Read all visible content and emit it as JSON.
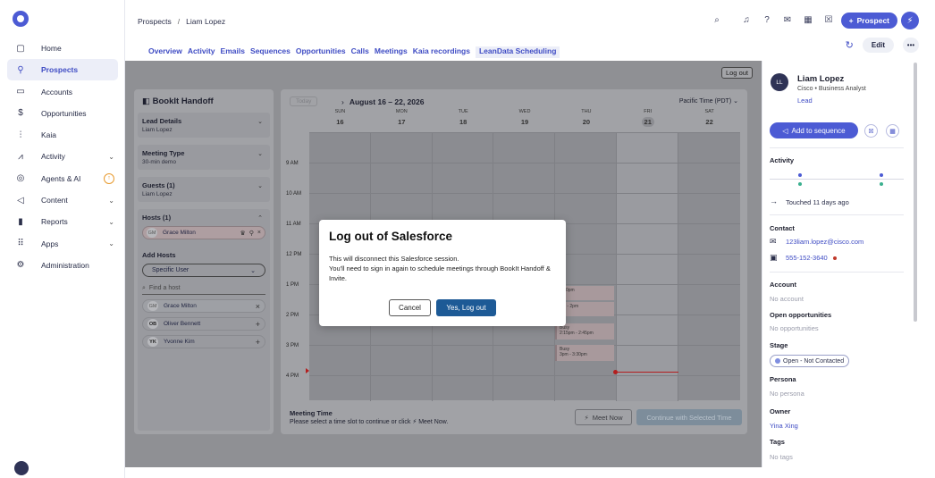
{
  "sidebar": {
    "items": [
      {
        "label": "Home",
        "icon": "home-icon",
        "glyph": "▢",
        "chevron": ""
      },
      {
        "label": "Prospects",
        "icon": "person-icon",
        "glyph": "⚲",
        "chevron": ""
      },
      {
        "label": "Accounts",
        "icon": "briefcase-icon",
        "glyph": "▭",
        "chevron": ""
      },
      {
        "label": "Opportunities",
        "icon": "dollar-icon",
        "glyph": "$",
        "chevron": ""
      },
      {
        "label": "Kaia",
        "icon": "waveform-icon",
        "glyph": "⫶",
        "chevron": ""
      },
      {
        "label": "Activity",
        "icon": "activity-icon",
        "glyph": "⩘",
        "chevron": "⌄"
      },
      {
        "label": "Agents & AI",
        "icon": "agents-icon",
        "glyph": "◎",
        "chevron": ""
      },
      {
        "label": "Content",
        "icon": "send-icon",
        "glyph": "◁",
        "chevron": "⌄"
      },
      {
        "label": "Reports",
        "icon": "bar-chart-icon",
        "glyph": "▮",
        "chevron": "⌄"
      },
      {
        "label": "Apps",
        "icon": "grid-icon",
        "glyph": "⠿",
        "chevron": "⌄"
      },
      {
        "label": "Administration",
        "icon": "gear-icon",
        "glyph": "⚙",
        "chevron": ""
      }
    ]
  },
  "topbar": {
    "breadcrumb_parent": "Prospects",
    "breadcrumb_sep": "/",
    "breadcrumb_current": "Liam Lopez",
    "new_prospect_label": "Prospect"
  },
  "tabs": [
    "Overview",
    "Activity",
    "Emails",
    "Sequences",
    "Opportunities",
    "Calls",
    "Meetings",
    "Kaia recordings",
    "LeanData Scheduling"
  ],
  "edit_label": "Edit",
  "main": {
    "logout_label": "Log out",
    "bookit": {
      "title": "BookIt Handoff",
      "lead_details_title": "Lead Details",
      "lead_details_value": "Liam Lopez",
      "meeting_type_title": "Meeting Type",
      "meeting_type_value": "30-min demo",
      "guests_title": "Guests (1)",
      "guests_value": "Liam Lopez",
      "hosts_title": "Hosts (1)",
      "selected_host_initials": "GM",
      "selected_host_name": "Grace Milton",
      "add_hosts_title": "Add Hosts",
      "user_select_value": "Specific User",
      "find_host_placeholder": "Find a host",
      "host_list": [
        {
          "initials": "GM",
          "name": "Grace Milton",
          "action": "×"
        },
        {
          "initials": "OB",
          "name": "Oliver Bennett",
          "action": "+"
        },
        {
          "initials": "YK",
          "name": "Yvonne Kim",
          "action": "+"
        }
      ]
    },
    "calendar": {
      "today_label": "Today",
      "range": "August 16 – 22, 2026",
      "timezone": "Pacific Time (PDT)",
      "days": [
        {
          "dow": "SUN",
          "num": "16"
        },
        {
          "dow": "MON",
          "num": "17"
        },
        {
          "dow": "TUE",
          "num": "18"
        },
        {
          "dow": "WED",
          "num": "19"
        },
        {
          "dow": "THU",
          "num": "20"
        },
        {
          "dow": "FRI",
          "num": "21"
        },
        {
          "dow": "SAT",
          "num": "22"
        }
      ],
      "hours": [
        "9 AM",
        "10 AM",
        "11 AM",
        "12 PM",
        "1 PM",
        "2 PM",
        "3 PM",
        "4 PM"
      ],
      "events": [
        {
          "title": "",
          "time": "1:30pm"
        },
        {
          "title": "",
          "time": "om - 2pm"
        },
        {
          "title": "Busy",
          "time": "2:15pm - 2:45pm"
        },
        {
          "title": "Busy",
          "time": "3pm - 3:30pm"
        }
      ],
      "meeting_time_title": "Meeting Time",
      "meeting_time_hint": "Please select a time slot to continue or click ⚡ Meet Now.",
      "meet_now_label": "Meet Now",
      "continue_label": "Continue with Selected Time"
    }
  },
  "modal": {
    "title": "Log out of Salesforce",
    "body_line1": "This will disconnect this Salesforce session.",
    "body_line2": "You'll need to sign in again to schedule meetings through BookIt Handoff & Invite.",
    "cancel_label": "Cancel",
    "confirm_label": "Yes, Log out"
  },
  "right_panel": {
    "avatar_initials": "LL",
    "name": "Liam Lopez",
    "company_title": "Cisco • Business Analyst",
    "type": "Lead",
    "add_sequence_label": "Add to sequence",
    "activity_title": "Activity",
    "touched": "Touched 11 days ago",
    "contact_title": "Contact",
    "email": "123liam.lopez@cisco.com",
    "phone": "555-152-3640",
    "account_title": "Account",
    "account_value": "No account",
    "opps_title": "Open opportunities",
    "opps_value": "No opportunities",
    "stage_title": "Stage",
    "stage_value": "Open - Not Contacted",
    "persona_title": "Persona",
    "persona_value": "No persona",
    "owner_title": "Owner",
    "owner_value": "Yina Xing",
    "tags_title": "Tags",
    "tags_value": "No tags"
  }
}
